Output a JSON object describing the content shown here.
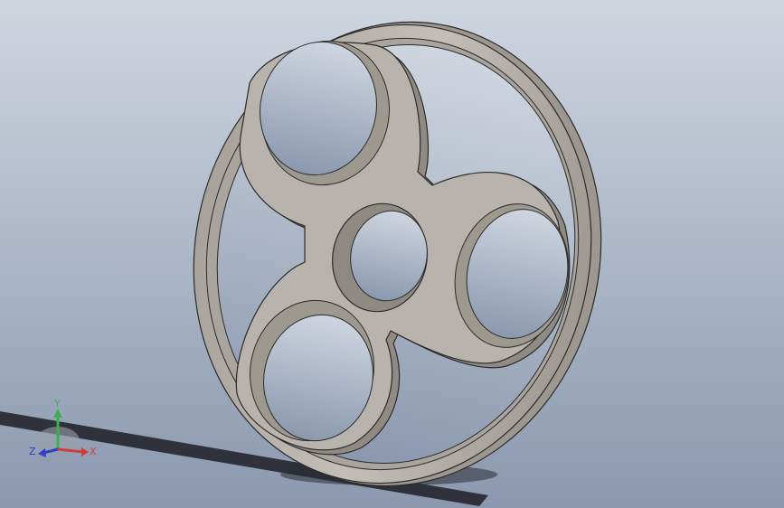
{
  "viewport": {
    "background_top": "#c9d2dd",
    "background_bottom": "#8e9bb0",
    "model_color": "#b5b1aa",
    "model_shadow": "#8c877f",
    "edge_color": "#2b2b2b"
  },
  "triad": {
    "x_label": "X",
    "y_label": "Y",
    "z_label": "Z",
    "x_color": "#d23b3b",
    "y_color": "#3ab04a",
    "z_color": "#2e3fc8"
  }
}
